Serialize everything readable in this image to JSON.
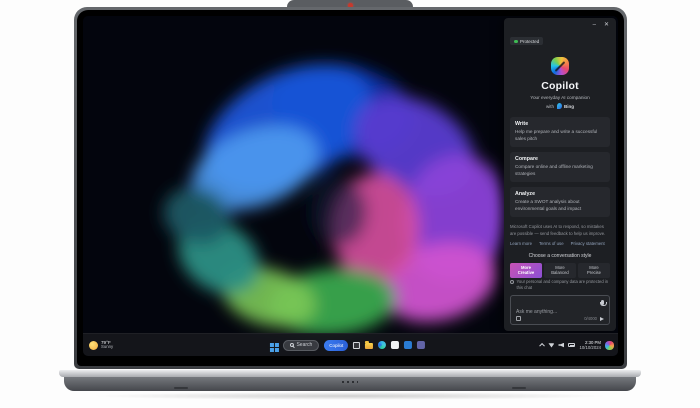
{
  "copilot_panel": {
    "window_controls": {
      "minimize": "–",
      "close": "✕"
    },
    "protected_badge": "Protected",
    "title": "Copilot",
    "subtitle": "Your everyday AI companion",
    "with_label": "with",
    "bing_label": "Bing",
    "cards": [
      {
        "title": "Write",
        "desc": "Help me prepare and write a successful sales pitch"
      },
      {
        "title": "Compare",
        "desc": "Compare online and offline marketing strategies"
      },
      {
        "title": "Analyze",
        "desc": "Create a SWOT analysis about environmental goals and impact"
      }
    ],
    "disclaimer": "Microsoft Copilot uses AI to respond, so mistakes are possible — send feedback to help us improve.",
    "links": {
      "learn_more": "Learn more",
      "terms": "Terms of use",
      "privacy": "Privacy statement"
    },
    "style_prompt": "Choose a conversation style",
    "styles": [
      {
        "line1": "More",
        "line2": "Creative",
        "selected": true
      },
      {
        "line1": "More",
        "line2": "Balanced",
        "selected": false
      },
      {
        "line1": "More",
        "line2": "Precise",
        "selected": false
      }
    ],
    "privacy_note": "Your personal and company data are protected in this chat",
    "input": {
      "placeholder": "Ask me anything...",
      "counter": "0/4000"
    }
  },
  "taskbar": {
    "weather": {
      "temp": "79°F",
      "condition": "Sunny"
    },
    "search_label": "Search",
    "copilot_button_label": "Copilot",
    "icons": [
      "start",
      "search",
      "copilot",
      "task-view",
      "file-explorer",
      "edge",
      "store",
      "outlook",
      "teams"
    ],
    "tray": {
      "time": "2:30 PM",
      "date": "10/10/2024"
    }
  },
  "colors": {
    "taskbar_accent": "#2a6ae0",
    "style_selected": "#b44fc8",
    "protected_green": "#3fba54",
    "panel_bg": "#1d1f23",
    "wallpaper_base": "#04060e"
  }
}
